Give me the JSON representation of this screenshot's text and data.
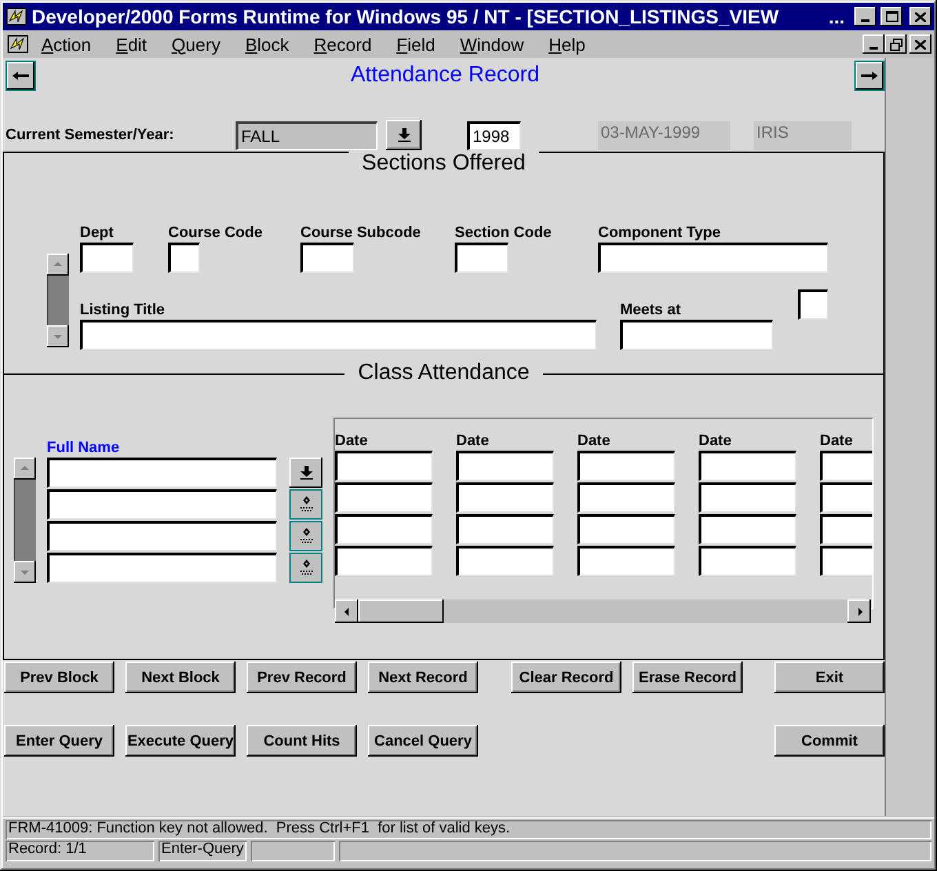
{
  "window": {
    "title": "Developer/2000 Forms Runtime for Windows 95 / NT - [SECTION_LISTINGS_VIEW",
    "title_overflow": "..."
  },
  "menu": [
    "Action",
    "Edit",
    "Query",
    "Block",
    "Record",
    "Field",
    "Window",
    "Help"
  ],
  "form": {
    "title": "Attendance Record"
  },
  "header": {
    "label": "Current Semester/Year:",
    "fields": [
      {
        "value": "FALL",
        "kind": "lov",
        "disabled": false
      },
      {
        "value": "1998",
        "kind": "text",
        "disabled": false
      },
      {
        "value": "03-MAY-1999",
        "kind": "display",
        "disabled": true
      },
      {
        "value": "IRIS",
        "kind": "display",
        "disabled": true
      }
    ]
  },
  "sections": {
    "title": "Sections Offered",
    "top_fields": [
      "Dept",
      "Course Code",
      "Course Subcode",
      "Section Code",
      "Component Type"
    ],
    "bottom_fields": [
      "Listing Title",
      "Meets at"
    ]
  },
  "attendance": {
    "title": "Class Attendance",
    "name_label": "Full Name",
    "rows": [
      {
        "kind": "lov"
      },
      {
        "kind": "flag"
      },
      {
        "kind": "flag"
      },
      {
        "kind": "flag"
      }
    ],
    "date_columns": [
      "Date",
      "Date",
      "Date",
      "Date",
      "Date"
    ]
  },
  "toolbar": [
    {
      "groups": [
        [
          "Prev Block",
          "Next Block",
          "Prev Record",
          "Next Record"
        ],
        [
          "Clear Record",
          "Erase Record"
        ]
      ],
      "end": "Exit"
    },
    {
      "groups": [
        [
          "Enter Query",
          "Execute Query",
          "Count Hits",
          "Cancel Query"
        ]
      ],
      "end": "Commit"
    }
  ],
  "status_bar": {
    "message": "FRM-41009: Function key not allowed.  Press Ctrl+F1  for list of valid keys.",
    "record": "Record: 1/1",
    "mode": "Enter-Query"
  }
}
